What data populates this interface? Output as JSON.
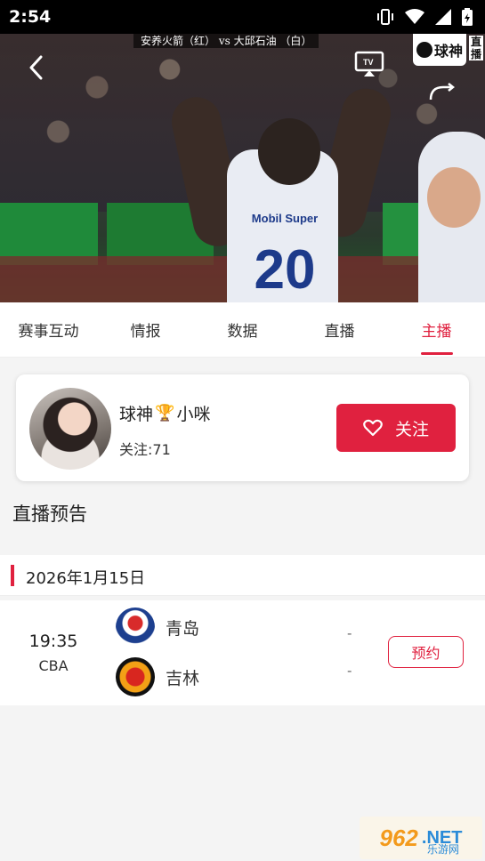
{
  "status_bar": {
    "time": "2:54",
    "icons": [
      "vibrate-icon",
      "wifi-icon",
      "signal-icon",
      "battery-icon"
    ]
  },
  "video": {
    "score_line": "安养火箭（红） vs 大邱石油 （白）",
    "jersey_sponsor": "Mobil Super",
    "jersey_number": "20",
    "brand_logo_text": "球神",
    "live_vertical": "直播"
  },
  "tabs": [
    {
      "label": "赛事互动",
      "active": false
    },
    {
      "label": "情报",
      "active": false
    },
    {
      "label": "数据",
      "active": false
    },
    {
      "label": "直播",
      "active": false
    },
    {
      "label": "主播",
      "active": true
    }
  ],
  "host": {
    "name_prefix": "球神",
    "name_suffix": "小咪",
    "follow_count": "关注:71",
    "follow_button": "关注"
  },
  "preview": {
    "title": "直播预告",
    "date": "2026年1月15日",
    "matches": [
      {
        "time": "19:35",
        "league": "CBA",
        "home": {
          "name": "青岛",
          "score": "-"
        },
        "away": {
          "name": "吉林",
          "score": "-"
        },
        "button": "预约"
      }
    ]
  },
  "watermark": {
    "main": "962",
    "suffix": ".NET",
    "sub": "乐游网"
  },
  "colors": {
    "accent": "#e0213f",
    "background": "#f4f4f4"
  }
}
